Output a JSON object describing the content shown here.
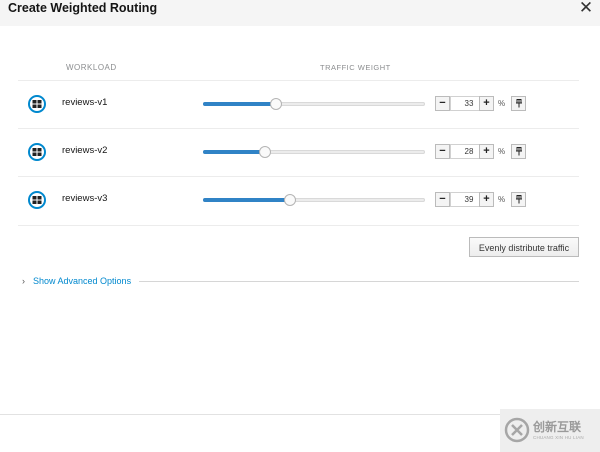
{
  "modal": {
    "title": "Create Weighted Routing",
    "close_icon": "close-icon"
  },
  "table": {
    "col_workload": "WORKLOAD",
    "col_traffic_weight": "TRAFFIC WEIGHT",
    "rows": [
      {
        "name": "reviews-v1",
        "weight": "33",
        "unit": "%",
        "icon": "workload-icon",
        "pin_icon": "pin-icon"
      },
      {
        "name": "reviews-v2",
        "weight": "28",
        "unit": "%",
        "icon": "workload-icon",
        "pin_icon": "pin-icon"
      },
      {
        "name": "reviews-v3",
        "weight": "39",
        "unit": "%",
        "icon": "workload-icon",
        "pin_icon": "pin-icon"
      }
    ],
    "decrement_label": "−",
    "increment_label": "+"
  },
  "actions": {
    "evenly_distribute_label": "Evenly distribute traffic"
  },
  "advanced": {
    "label": "Show Advanced Options",
    "chevron": "›"
  },
  "watermark": {
    "text": "创新互联",
    "subtext": "CHUANG XIN HU LIAN"
  },
  "colors": {
    "accent": "#0088ce",
    "slider_fill": "#3083c6",
    "header_bg": "#f5f5f5"
  }
}
